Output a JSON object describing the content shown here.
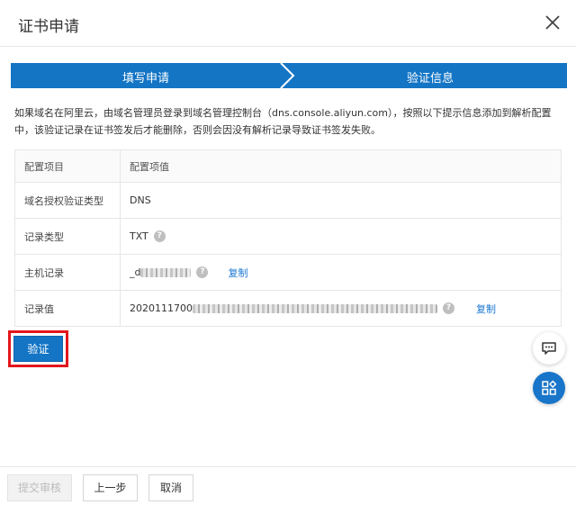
{
  "dialog": {
    "title": "证书申请"
  },
  "steps": [
    {
      "label": "填写申请"
    },
    {
      "label": "验证信息"
    }
  ],
  "description": "如果域名在阿里云，由域名管理员登录到域名管理控制台（dns.console.aliyun.com），按照以下提示信息添加到解析配置中，该验证记录在证书签发后才能删除，否则会因没有解析记录导致证书签发失败。",
  "table": {
    "headers": {
      "key": "配置项目",
      "value": "配置项值"
    },
    "rows": [
      {
        "key": "域名授权验证类型",
        "value": "DNS"
      },
      {
        "key": "记录类型",
        "value": "TXT"
      },
      {
        "key": "主机记录",
        "value": "_d"
      },
      {
        "key": "记录值",
        "value": "2020111700"
      }
    ],
    "copy_label": "复制"
  },
  "verify_button": "验证",
  "footer": {
    "submit": "提交审核",
    "prev": "上一步",
    "cancel": "取消"
  },
  "colors": {
    "primary": "#1475c5",
    "highlight_border": "#e3161c",
    "link": "#1a76d2"
  },
  "icons": {
    "close": "close-icon",
    "help": "question-circle-icon",
    "chat": "chat-bubble-icon",
    "apps": "apps-grid-icon"
  }
}
